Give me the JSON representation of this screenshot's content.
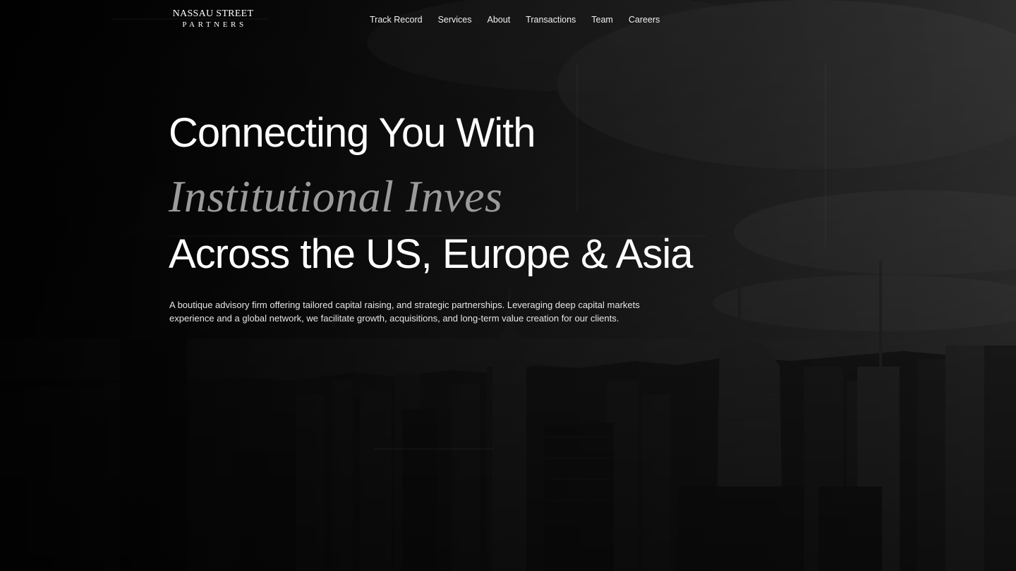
{
  "brand": {
    "name_line1": "NASSAU STREET",
    "name_line2": "PARTNERS"
  },
  "nav": {
    "items": [
      {
        "label": "Track Record"
      },
      {
        "label": "Services"
      },
      {
        "label": "About"
      },
      {
        "label": "Transactions"
      },
      {
        "label": "Team"
      },
      {
        "label": "Careers"
      }
    ]
  },
  "hero": {
    "line1": "Connecting You With",
    "line2": "Institutional Inves",
    "line3": "Across the US, Europe & Asia",
    "description": "A boutique advisory firm offering tailored capital raising, and strategic partnerships. Leveraging deep capital markets experience and a global network, we facilitate growth, acquisitions, and long-term value creation for our clients."
  },
  "colors": {
    "background": "#0a0a0a",
    "text": "#ffffff",
    "accent_italic": "#9b9b9b"
  }
}
